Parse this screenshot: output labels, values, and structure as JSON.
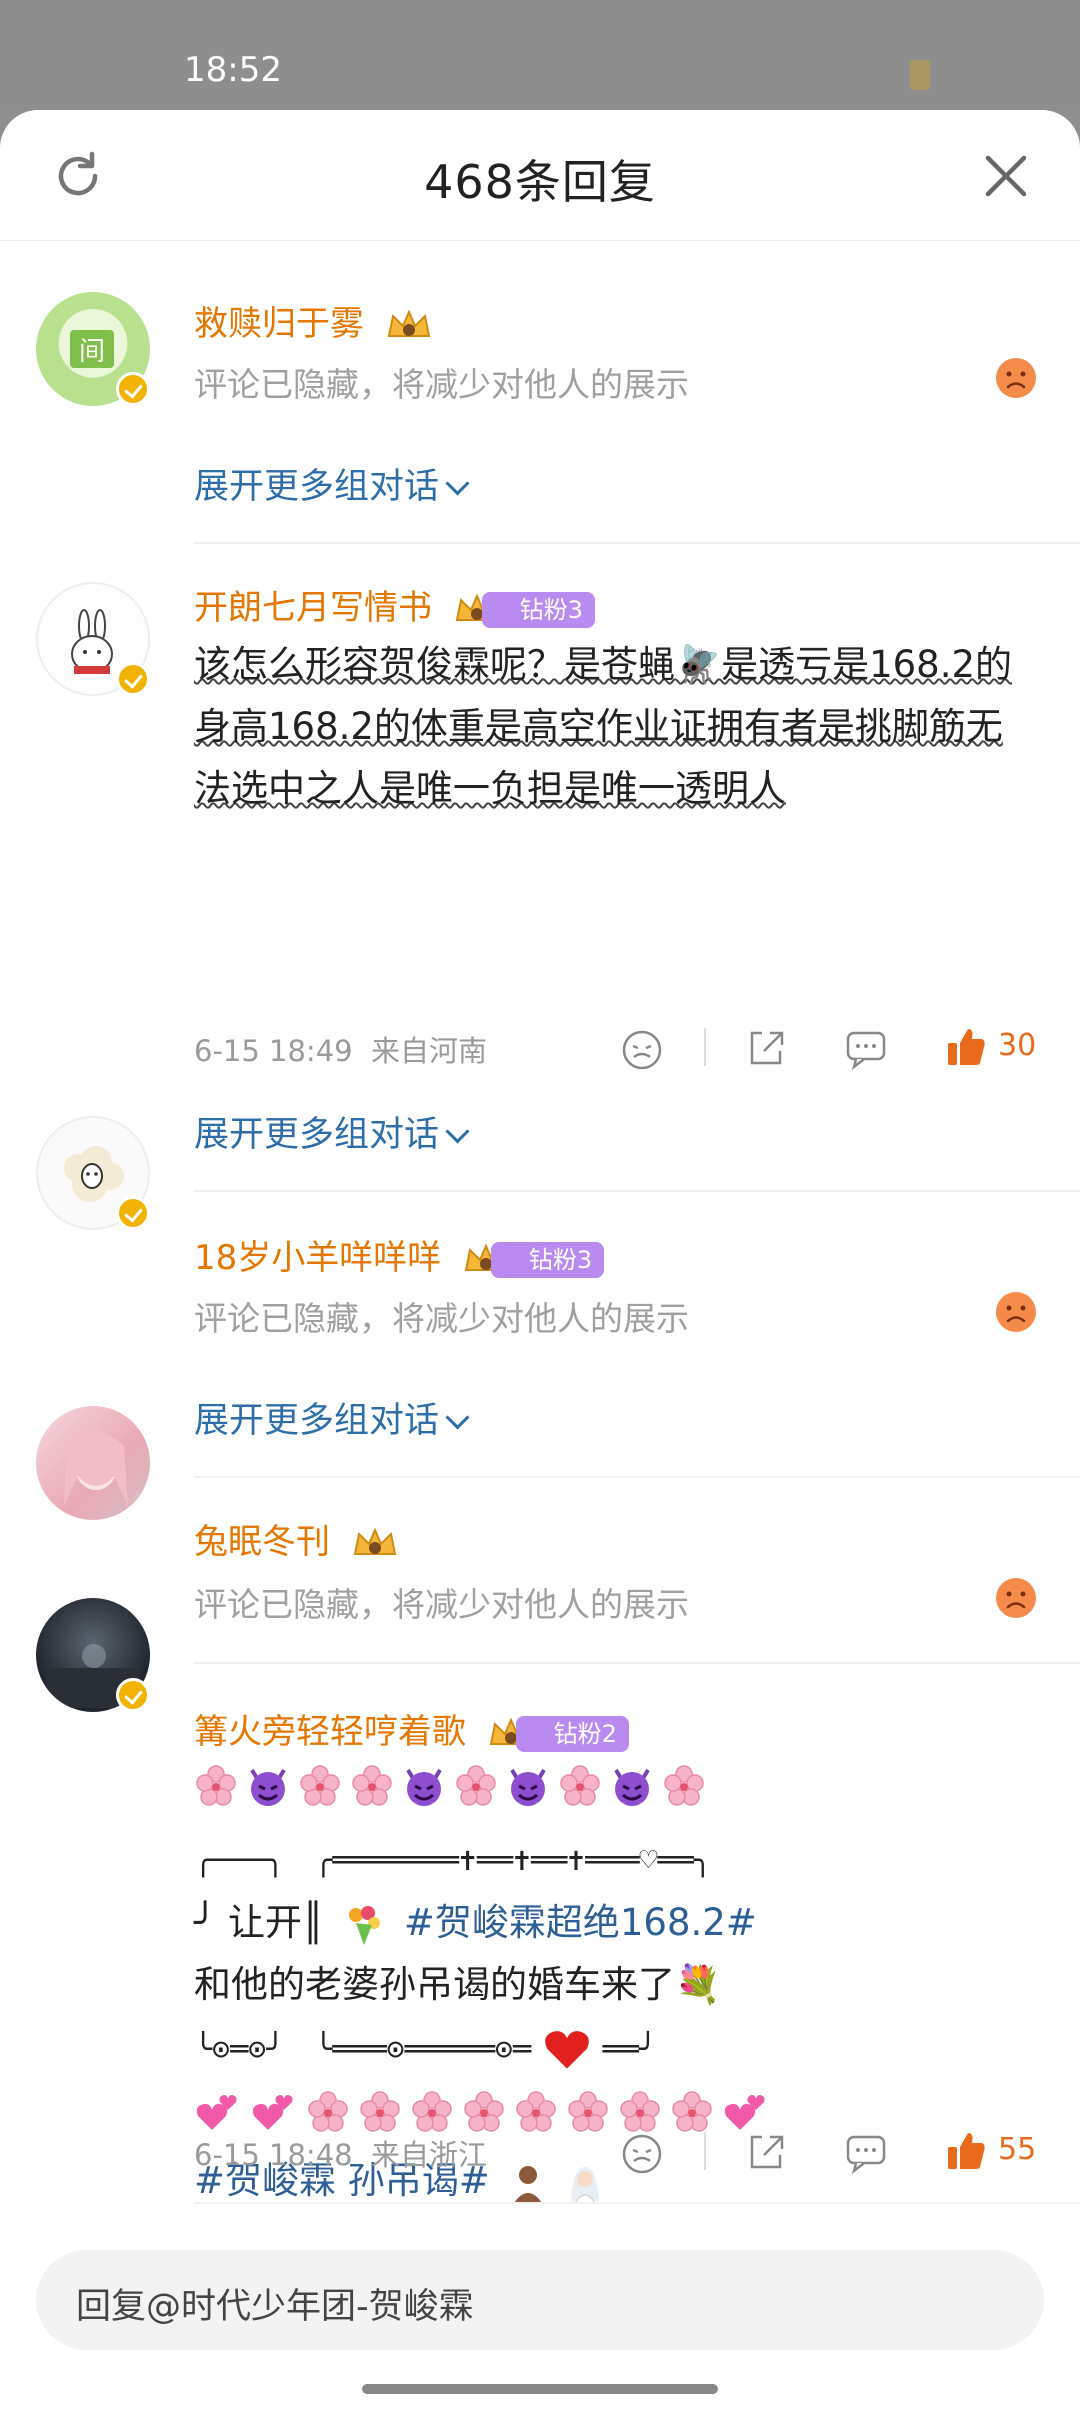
{
  "status": {
    "time": "18:52"
  },
  "header": {
    "title": "468条回复"
  },
  "comments": [
    {
      "name": "救赎归于雾",
      "hidden_text": "评论已隐藏，将减少对他人的展示",
      "expand": "展开更多组对话"
    },
    {
      "name": "开朗七月写情书",
      "fan_badge": "钻粉3",
      "body": "该怎么形容贺俊霖呢？是苍蝇🪰是透亏是168.2的身高168.2的体重是高空作业证拥有者是挑脚筋无法选中之人是唯一负担是唯一透明人",
      "time": "6-15 18:49",
      "location": "来自河南",
      "likes": "30",
      "expand": "展开更多组对话"
    },
    {
      "name": "18岁小羊咩咩咩",
      "fan_badge": "钻粉3",
      "hidden_text": "评论已隐藏，将减少对他人的展示",
      "expand": "展开更多组对话"
    },
    {
      "name": "兔眠冬刊",
      "hidden_text": "评论已隐藏，将减少对他人的展示"
    },
    {
      "name": "篝火旁轻轻哼着歌",
      "fan_badge": "钻粉2",
      "line_a": "╭───╮　╭═══════✝══✝══✝═══♡══╮",
      "line_b_prefix": "╯ 让开║",
      "line_b_tag": "#贺峻霖超绝168.2#",
      "line_c": "和他的老婆孙吊谒的婚车来了💐",
      "line_d": "╰⊙═⊙╯　╰═══⊙═════⊙═",
      "line_e_tag": "#贺峻霖 孙吊谒#",
      "time": "6-15 18:48",
      "location": "来自浙江",
      "likes": "55"
    }
  ],
  "reply_box": {
    "placeholder": "回复@时代少年团-贺峻霖"
  }
}
